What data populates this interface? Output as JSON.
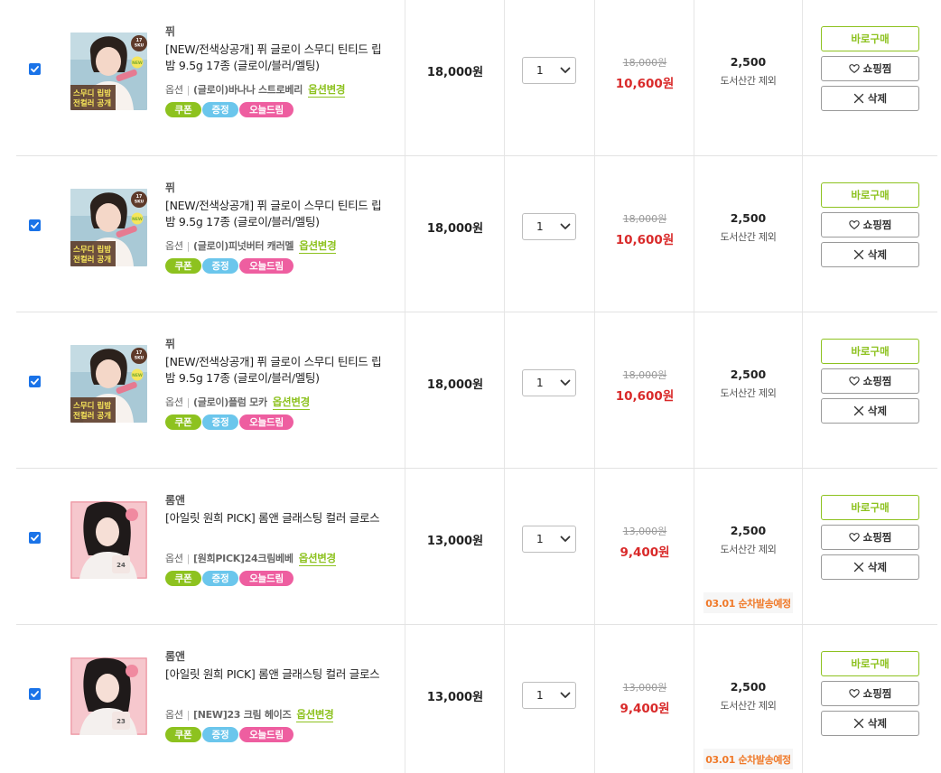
{
  "labels": {
    "option_prefix": "옵션",
    "option_sep": "|",
    "option_change": "옵션변경",
    "badge_coupon": "쿠폰",
    "badge_gift": "증정",
    "badge_today": "오늘드림",
    "ship_note": "도서산간 제외",
    "btn_buy": "바로구매",
    "btn_wish": "쇼핑찜",
    "btn_delete": "삭제"
  },
  "colors": {
    "accent_green": "#8dc21f",
    "sale_red": "#d92a2a",
    "ship_orange": "#f07a2a",
    "badge_blue": "#6bc6ec",
    "badge_pink": "#ee5ea0"
  },
  "items": [
    {
      "checked": true,
      "brand": "퓌",
      "name": "[NEW/전색상공개] 퓌 글로이 스무디 틴티드 립밤 9.5g 17종 (글로이/블러/멜팅)",
      "option": "(글로이)바나나 스트로베리",
      "price": "18,000원",
      "qty": "1",
      "original_price": "18,000원",
      "sale_price": "10,600원",
      "shipping_fee": "2,500",
      "shipping_badge": "",
      "thumb_text": [
        "스무디 립밤",
        "전컬러 공개"
      ],
      "thumb_tag": "17 SKU",
      "thumb_new": "NEW"
    },
    {
      "checked": true,
      "brand": "퓌",
      "name": "[NEW/전색상공개] 퓌 글로이 스무디 틴티드 립밤 9.5g 17종 (글로이/블러/멜팅)",
      "option": "(글로이)피넛버터 캐러멜",
      "price": "18,000원",
      "qty": "1",
      "original_price": "18,000원",
      "sale_price": "10,600원",
      "shipping_fee": "2,500",
      "shipping_badge": "",
      "thumb_text": [
        "스무디 립밤",
        "전컬러 공개"
      ],
      "thumb_tag": "17 SKU",
      "thumb_new": "NEW"
    },
    {
      "checked": true,
      "brand": "퓌",
      "name": "[NEW/전색상공개] 퓌 글로이 스무디 틴티드 립밤 9.5g 17종 (글로이/블러/멜팅)",
      "option": "(글로이)플럼 모카",
      "price": "18,000원",
      "qty": "1",
      "original_price": "18,000원",
      "sale_price": "10,600원",
      "shipping_fee": "2,500",
      "shipping_badge": "",
      "thumb_text": [
        "스무디 립밤",
        "전컬러 공개"
      ],
      "thumb_tag": "17 SKU",
      "thumb_new": "NEW"
    },
    {
      "checked": true,
      "brand": "롬앤",
      "name": "[아일릿 원희 PICK] 롬앤 글래스팅 컬러 글로스",
      "option": "[원희PICK]24크림베베",
      "price": "13,000원",
      "qty": "1",
      "original_price": "13,000원",
      "sale_price": "9,400원",
      "shipping_fee": "2,500",
      "shipping_badge": "03.01 순차발송예정",
      "thumb_text": [],
      "thumb_tag": "",
      "thumb_new": ""
    },
    {
      "checked": true,
      "brand": "롬앤",
      "name": "[아일릿 원희 PICK] 롬앤 글래스팅 컬러 글로스",
      "option": "[NEW]23 크림 헤이즈",
      "price": "13,000원",
      "qty": "1",
      "original_price": "13,000원",
      "sale_price": "9,400원",
      "shipping_fee": "2,500",
      "shipping_badge": "03.01 순차발송예정",
      "thumb_text": [],
      "thumb_tag": "",
      "thumb_new": ""
    }
  ]
}
